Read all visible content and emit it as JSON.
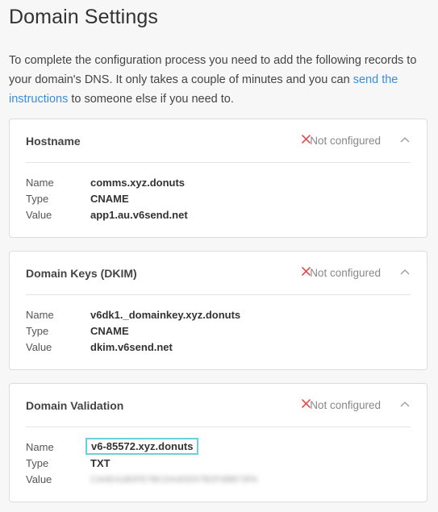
{
  "page": {
    "title": "Domain Settings",
    "intro_before": "To complete the configuration process you need to add the following records to your domain's DNS. It only takes a couple of minutes and you can ",
    "intro_link": "send the instructions",
    "intro_after": " to someone else if you need to."
  },
  "colors": {
    "error": "#e34c4c",
    "link": "#3a8dde",
    "highlight": "#6cd0dc"
  },
  "records": [
    {
      "title": "Hostname",
      "status": "Not configured",
      "labels": {
        "name": "Name",
        "type": "Type",
        "value": "Value"
      },
      "name": "comms.xyz.donuts",
      "type": "CNAME",
      "value": "app1.au.v6send.net"
    },
    {
      "title": "Domain Keys (DKIM)",
      "status": "Not configured",
      "labels": {
        "name": "Name",
        "type": "Type",
        "value": "Value"
      },
      "name": "v6dk1._domainkey.xyz.donuts",
      "type": "CNAME",
      "value": "dkim.v6send.net"
    },
    {
      "title": "Domain Validation",
      "status": "Not configured",
      "labels": {
        "name": "Name",
        "type": "Type",
        "value": "Value"
      },
      "name": "v6-85572.xyz.donuts",
      "type": "TXT",
      "value": "CAAE41B0FE7BCDA4DD57B2F0BB73FA"
    }
  ]
}
